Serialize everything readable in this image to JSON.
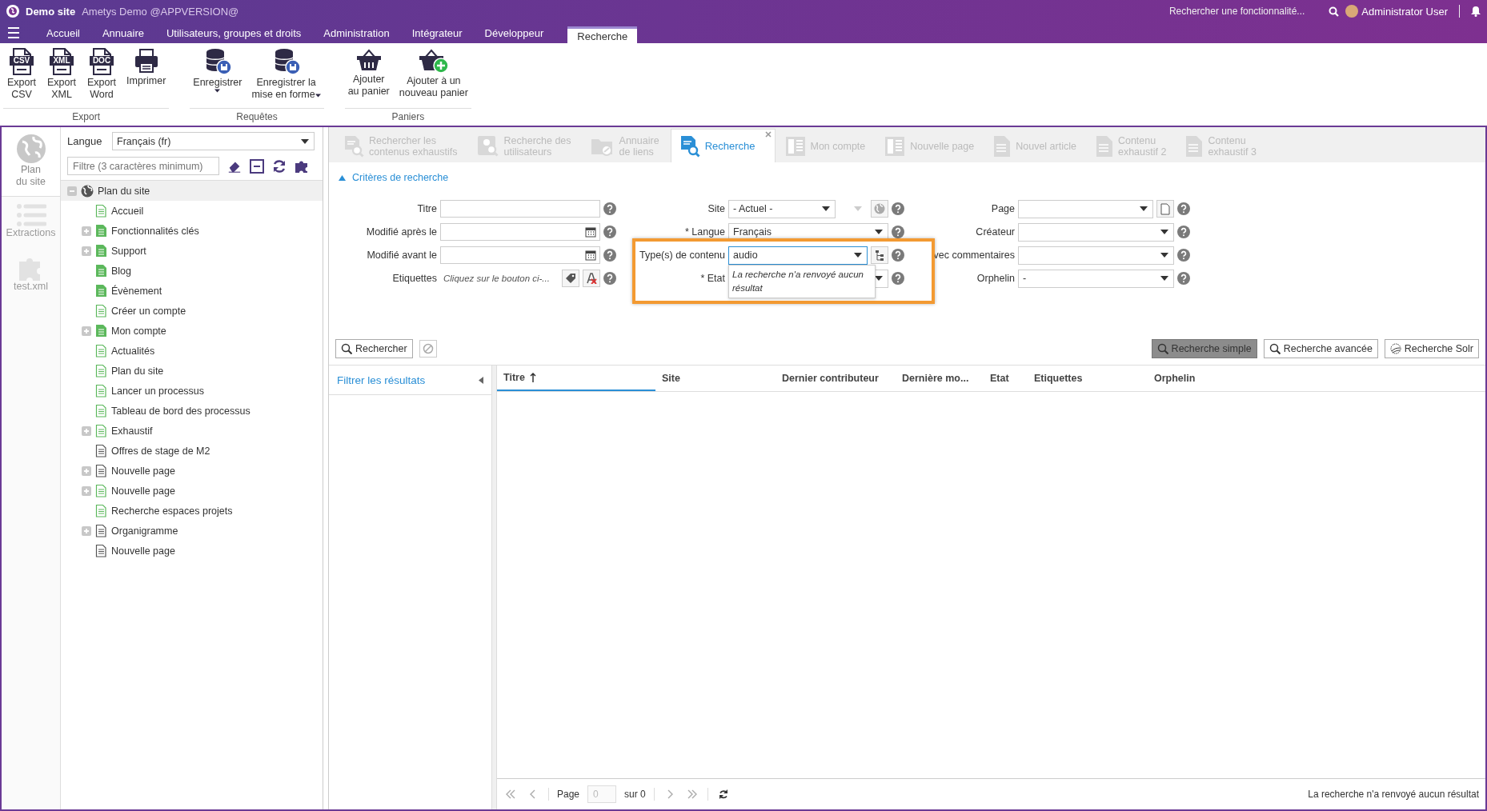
{
  "app_bar": {
    "site": "Demo site",
    "app": "Ametys Demo @APPVERSION@",
    "search_placeholder": "Rechercher une fonctionnalité...",
    "user": "Administrator User"
  },
  "menu_tabs": [
    {
      "label": "Accueil",
      "selected": false
    },
    {
      "label": "Annuaire",
      "selected": false
    },
    {
      "label": "Utilisateurs, groupes et droits",
      "selected": false
    },
    {
      "label": "Administration",
      "selected": false
    },
    {
      "label": "Intégrateur",
      "selected": false
    },
    {
      "label": "Développeur",
      "selected": false
    },
    {
      "label": "Recherche",
      "selected": true
    }
  ],
  "ribbon_groups": [
    {
      "title": "Export",
      "buttons": [
        {
          "label": "Export\nCSV",
          "kind": "file",
          "icon_text": "CSV",
          "dropdown": false
        },
        {
          "label": "Export\nXML",
          "kind": "file",
          "icon_text": "XML",
          "dropdown": false
        },
        {
          "label": "Export\nWord",
          "kind": "file",
          "icon_text": "DOC",
          "dropdown": false
        },
        {
          "label": "Imprimer",
          "kind": "printer",
          "dropdown": false
        }
      ]
    },
    {
      "title": "Requêtes",
      "buttons": [
        {
          "label": "Enregistrer",
          "kind": "database",
          "dropdown": true
        },
        {
          "label": "Enregistrer la\nmise en forme",
          "kind": "database",
          "dropdown": true
        }
      ]
    },
    {
      "title": "Paniers",
      "buttons": [
        {
          "label": "Ajouter\nau panier",
          "kind": "basket",
          "dropdown": false
        },
        {
          "label": "Ajouter à un\nnouveau panier",
          "kind": "basket-add",
          "dropdown": false
        }
      ]
    }
  ],
  "side_tabs": [
    {
      "label": "Plan\ndu site",
      "kind": "globe",
      "selected": true
    },
    {
      "label": "Extractions",
      "kind": "list",
      "selected": false
    },
    {
      "label": "test.xml",
      "kind": "puzzle",
      "selected": false
    }
  ],
  "sitemap": {
    "language_label": "Langue",
    "language": "Français (fr)",
    "filter_placeholder": "Filtre (3 caractères minimum)",
    "root": {
      "label": "Plan du site",
      "expanded": true,
      "selected": true,
      "children": [
        {
          "label": "Accueil",
          "has_children": false,
          "color": "#5cb85c",
          "filled": false
        },
        {
          "label": "Fonctionnalités clés",
          "has_children": true,
          "color": "#5cb85c",
          "filled": true
        },
        {
          "label": "Support",
          "has_children": true,
          "color": "#5cb85c",
          "filled": true
        },
        {
          "label": "Blog",
          "has_children": false,
          "color": "#5cb85c",
          "filled": true
        },
        {
          "label": "Évènement",
          "has_children": false,
          "color": "#5cb85c",
          "filled": true
        },
        {
          "label": "Créer un compte",
          "has_children": false,
          "color": "#5cb85c",
          "filled": false
        },
        {
          "label": "Mon compte",
          "has_children": true,
          "color": "#5cb85c",
          "filled": true
        },
        {
          "label": "Actualités",
          "has_children": false,
          "color": "#5cb85c",
          "filled": false
        },
        {
          "label": "Plan du site",
          "has_children": false,
          "color": "#5cb85c",
          "filled": false
        },
        {
          "label": "Lancer un processus",
          "has_children": false,
          "color": "#5cb85c",
          "filled": false
        },
        {
          "label": "Tableau de bord des processus",
          "has_children": false,
          "color": "#5cb85c",
          "filled": false
        },
        {
          "label": "Exhaustif",
          "has_children": true,
          "color": "#5cb85c",
          "filled": false
        },
        {
          "label": "Offres de stage de M2",
          "has_children": false,
          "color": "#555555",
          "filled": false
        },
        {
          "label": "Nouvelle page",
          "has_children": true,
          "color": "#555555",
          "filled": false
        },
        {
          "label": "Nouvelle page",
          "has_children": true,
          "color": "#5cb85c",
          "filled": false
        },
        {
          "label": "Recherche espaces projets",
          "has_children": false,
          "color": "#5cb85c",
          "filled": false
        },
        {
          "label": "Organigramme",
          "has_children": true,
          "color": "#555555",
          "filled": false
        },
        {
          "label": "Nouvelle page",
          "has_children": false,
          "color": "#555555",
          "filled": false
        }
      ]
    }
  },
  "doc_tabs": [
    {
      "label": "Rechercher les\ncontenus exhaustifs",
      "kind": "search-doc",
      "selected": false,
      "closable": false
    },
    {
      "label": "Recherche des\nutilisateurs",
      "kind": "user-search",
      "selected": false,
      "closable": false
    },
    {
      "label": "Annuaire\nde liens",
      "kind": "folder-link",
      "selected": false,
      "closable": false
    },
    {
      "label": "Recherche",
      "kind": "search-doc",
      "selected": true,
      "closable": true
    },
    {
      "label": "Mon compte",
      "kind": "layout",
      "selected": false,
      "closable": false
    },
    {
      "label": "Nouvelle page",
      "kind": "layout",
      "selected": false,
      "closable": false
    },
    {
      "label": "Nouvel article",
      "kind": "doc",
      "selected": false,
      "closable": false
    },
    {
      "label": "Contenu\nexhaustif 2",
      "kind": "doc",
      "selected": false,
      "closable": false
    },
    {
      "label": "Contenu\nexhaustif 3",
      "kind": "doc",
      "selected": false,
      "closable": false
    }
  ],
  "criteria": {
    "title": "Critères de recherche",
    "expanded": true,
    "rows": [
      [
        {
          "label": "Titre",
          "kind": "text"
        },
        {
          "label": "Site",
          "kind": "site-combo",
          "value": "- Actuel -"
        },
        {
          "label": "Page",
          "kind": "page-combo"
        }
      ],
      [
        {
          "label": "Modifié après le",
          "kind": "date"
        },
        {
          "label": "* Langue",
          "kind": "combo",
          "value": "Français"
        },
        {
          "label": "Créateur",
          "kind": "combo"
        }
      ],
      [
        {
          "label": "Modifié avant le",
          "kind": "date"
        },
        {
          "label": "Type(s) de contenu",
          "kind": "type-combo",
          "value": "audio",
          "focused": true,
          "highlighted": true,
          "popup": "La recherche n'a renvoyé aucun résultat"
        },
        {
          "label": "vec commentaires",
          "kind": "combo"
        }
      ],
      [
        {
          "label": "Etiquettes",
          "kind": "tags",
          "value": "Cliquez sur le bouton ci-..."
        },
        {
          "label": "* Etat",
          "kind": "combo"
        },
        {
          "label": "Orphelin",
          "kind": "combo",
          "value": "-"
        }
      ]
    ]
  },
  "search_button": "Rechercher",
  "modes": [
    {
      "label": "Recherche simple",
      "kind": "search",
      "selected": true
    },
    {
      "label": "Recherche avancée",
      "kind": "search",
      "selected": false
    },
    {
      "label": "Recherche Solr",
      "kind": "solr",
      "selected": false
    }
  ],
  "filter_panel": {
    "title": "Filtrer les résultats"
  },
  "grid": {
    "columns": [
      {
        "label": "Titre",
        "sorted": true
      },
      {
        "label": "Site",
        "sorted": false
      },
      {
        "label": "Dernier contributeur",
        "sorted": false
      },
      {
        "label": "Dernière mo...",
        "sorted": false
      },
      {
        "label": "Etat",
        "sorted": false
      },
      {
        "label": "Etiquettes",
        "sorted": false
      },
      {
        "label": "Orphelin",
        "sorted": false
      }
    ]
  },
  "pager": {
    "page_label": "Page",
    "page": "0",
    "total": "sur 0",
    "status": "La recherche n'a renvoyé aucun résultat"
  }
}
